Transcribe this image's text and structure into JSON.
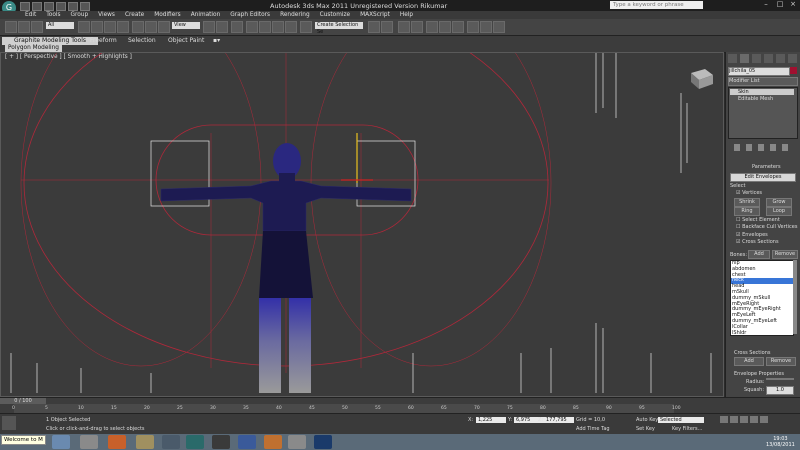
{
  "titlebar": {
    "logo_label": "G",
    "title": "Autodesk 3ds Max 2011   Unregistered Version   Rikumar",
    "search_placeholder": "Type a keyword or phrase",
    "minimize": "–",
    "maximize": "□",
    "close": "×"
  },
  "menus": [
    "Edit",
    "Tools",
    "Group",
    "Views",
    "Create",
    "Modifiers",
    "Animation",
    "Graph Editors",
    "Rendering",
    "Customize",
    "MAXScript",
    "Help"
  ],
  "toolbar": {
    "filter_value": "All",
    "refcoord_value": "View",
    "selection_set_placeholder": "Create Selection Se"
  },
  "ribbon": {
    "tabs": [
      "Graphite Modeling Tools",
      "Freeform",
      "Selection",
      "Object Paint"
    ],
    "panel_label": "Polygon Modeling"
  },
  "viewport": {
    "label": "[ + ] [ Perspective ] [ Smooth + Highlights ]"
  },
  "command_panel": {
    "object_name": "jillchila_05",
    "modifier_list": "Modifier List",
    "stack": [
      "Skin",
      "Editable Mesh"
    ],
    "rollout_title": "Parameters",
    "edit_envelopes": "Edit Envelopes",
    "select_label": "Select",
    "vertices_label": "Vertices",
    "btn_shrink": "Shrink",
    "btn_grow": "Grow",
    "btn_ring": "Ring",
    "btn_loop": "Loop",
    "select_element": "Select Element",
    "backface_cull": "Backface Cull Vertices",
    "envelopes": "Envelopes",
    "cross_sections": "Cross Sections",
    "bones_label": "Bones:",
    "add": "Add",
    "remove": "Remove",
    "bones": [
      "hip",
      "abdomen",
      "chest",
      "neck",
      "head",
      "mSkull",
      "dummy_mSkull",
      "mEyeRight",
      "dummy_mEyeRight",
      "mEyeLeft",
      "dummy_mEyeLeft",
      "lCollar",
      "lShldr",
      "lForeArm"
    ],
    "selected_bone": "neck",
    "cross_sections_title": "Cross Sections",
    "cs_add": "Add",
    "cs_remove": "Remove",
    "envelope_properties": "Envelope Properties",
    "radius_label": "Radius:",
    "squash_label": "Squash:",
    "squash_value": "1.0"
  },
  "timeline": {
    "slider_label": "0 / 100",
    "ticks": [
      "0",
      "5",
      "10",
      "15",
      "20",
      "25",
      "30",
      "35",
      "40",
      "45",
      "50",
      "55",
      "60",
      "65",
      "70",
      "75",
      "80",
      "85",
      "90",
      "95",
      "100"
    ]
  },
  "statusbar": {
    "selection_info": "1 Object Selected",
    "prompt": "Click or click-and-drag to select objects",
    "x_label": "X:",
    "x_value": "1,225",
    "y_label": "Y:",
    "y_value": "6,975",
    "z_label": "Z:",
    "z_value": "177,795",
    "grid": "Grid = 10,0",
    "add_time_tag": "Add Time Tag",
    "auto_key": "Auto Key",
    "auto_key_mode": "Selected",
    "set_key": "Set Key",
    "key_filters": "Key Filters..."
  },
  "taskbar": {
    "tooltip": "Welcome to M",
    "time": "19:03",
    "date": "13/08/2011"
  },
  "colors": {
    "background": "#2b2b2b",
    "viewport": "#3b3b3b",
    "envelope": "#c0303a",
    "highlight": "#3875d7",
    "taskbar": "#5a6a78"
  }
}
